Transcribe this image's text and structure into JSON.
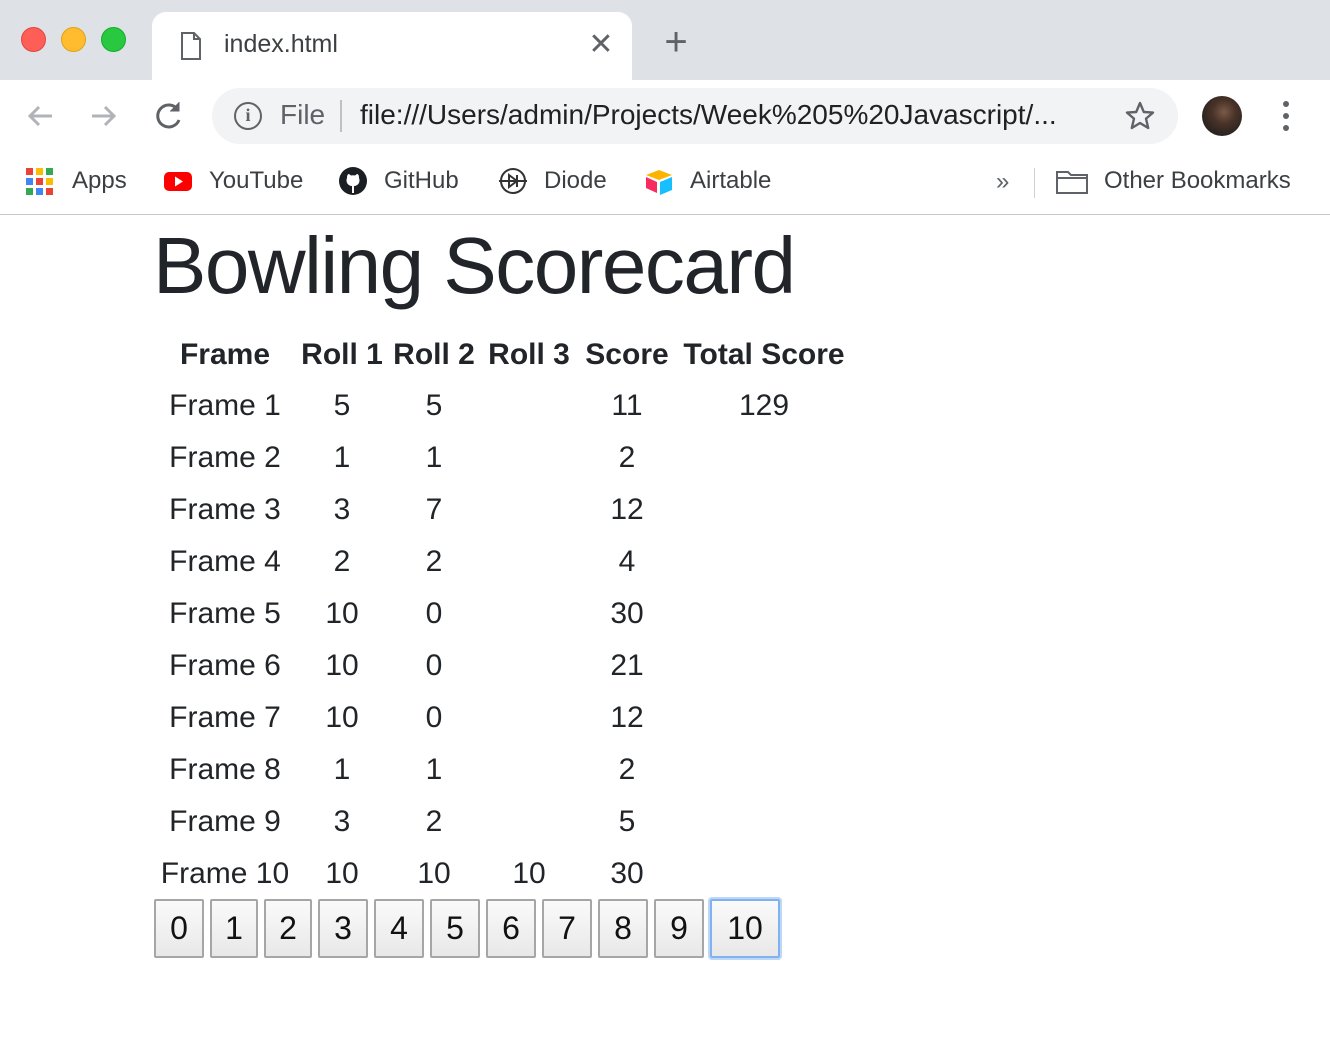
{
  "browser": {
    "tab_title": "index.html",
    "close_symbol": "✕",
    "new_tab_symbol": "+",
    "url_scheme": "File",
    "url": "file:///Users/admin/Projects/Week%205%20Javascript/...",
    "info_symbol": "i",
    "bookmarks": [
      {
        "label": "Apps",
        "icon": "apps-grid-icon"
      },
      {
        "label": "YouTube",
        "icon": "youtube-icon"
      },
      {
        "label": "GitHub",
        "icon": "github-icon"
      },
      {
        "label": "Diode",
        "icon": "diode-icon"
      },
      {
        "label": "Airtable",
        "icon": "airtable-icon"
      }
    ],
    "overflow_symbol": "»",
    "other_bookmarks": "Other Bookmarks"
  },
  "page": {
    "title": "Bowling Scorecard",
    "headers": [
      "Frame",
      "Roll 1",
      "Roll 2",
      "Roll 3",
      "Score",
      "Total Score"
    ],
    "rows": [
      [
        "Frame 1",
        "5",
        "5",
        "",
        "11",
        "129"
      ],
      [
        "Frame 2",
        "1",
        "1",
        "",
        "2",
        ""
      ],
      [
        "Frame 3",
        "3",
        "7",
        "",
        "12",
        ""
      ],
      [
        "Frame 4",
        "2",
        "2",
        "",
        "4",
        ""
      ],
      [
        "Frame 5",
        "10",
        "0",
        "",
        "30",
        ""
      ],
      [
        "Frame 6",
        "10",
        "0",
        "",
        "21",
        ""
      ],
      [
        "Frame 7",
        "10",
        "0",
        "",
        "12",
        ""
      ],
      [
        "Frame 8",
        "1",
        "1",
        "",
        "2",
        ""
      ],
      [
        "Frame 9",
        "3",
        "2",
        "",
        "5",
        ""
      ],
      [
        "Frame 10",
        "10",
        "10",
        "10",
        "30",
        ""
      ]
    ],
    "pin_buttons": [
      "0",
      "1",
      "2",
      "3",
      "4",
      "5",
      "6",
      "7",
      "8",
      "9",
      "10"
    ],
    "focused_button": "10"
  },
  "colors": {
    "tabstrip": "#dee1e6",
    "omnibox": "#f1f3f4",
    "focus_ring": "#7fb2ef"
  }
}
